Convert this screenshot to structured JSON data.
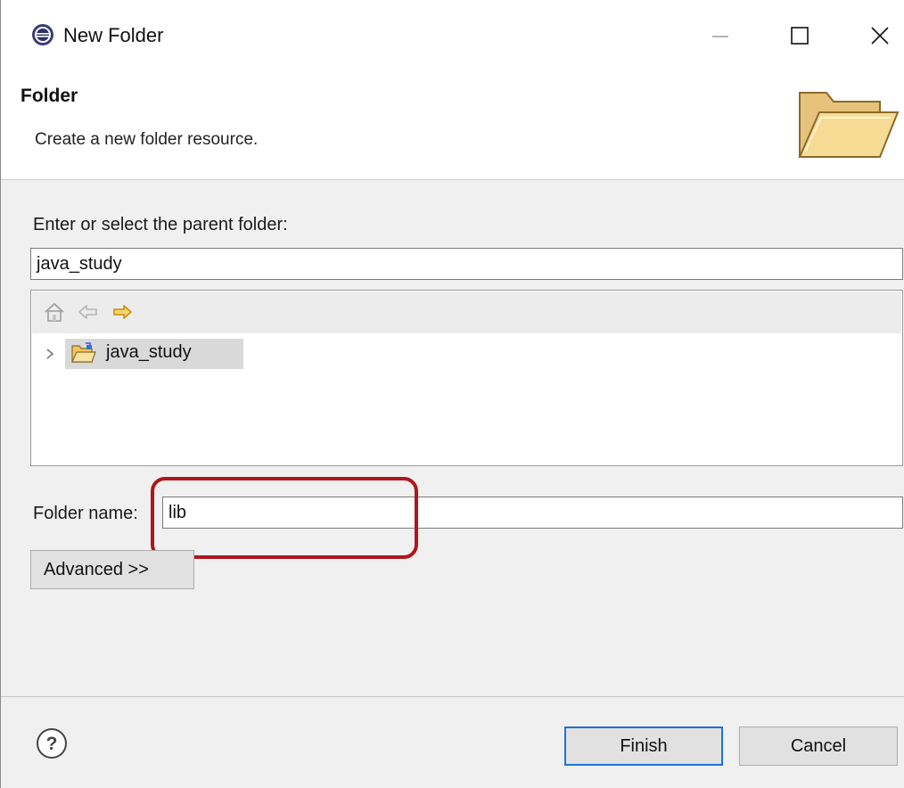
{
  "window": {
    "title": "New Folder",
    "app_icon": "eclipse-icon",
    "controls": [
      "minimize-icon",
      "maximize-icon",
      "close-icon"
    ]
  },
  "banner": {
    "title": "Folder",
    "description": "Create a new folder resource.",
    "icon": "open-folder-icon"
  },
  "parent": {
    "label": "Enter or select the parent folder:",
    "value": "java_study"
  },
  "tree": {
    "toolbar_icons": [
      "home-icon",
      "back-arrow-icon",
      "forward-arrow-icon"
    ],
    "items": [
      {
        "label": "java_study",
        "icon": "project-folder-icon",
        "expanded": false,
        "selected": true
      }
    ]
  },
  "folder_name": {
    "label": "Folder name:",
    "value": "lib"
  },
  "advanced_button": "Advanced >>",
  "footer": {
    "help_icon": "help-icon",
    "finish": "Finish",
    "cancel": "Cancel"
  },
  "colors": {
    "highlight_box": "#b0161a",
    "default_button_border": "#1a73d9",
    "selection_bg": "#d9d9d9",
    "folder_yellow": "#f2c75c"
  }
}
